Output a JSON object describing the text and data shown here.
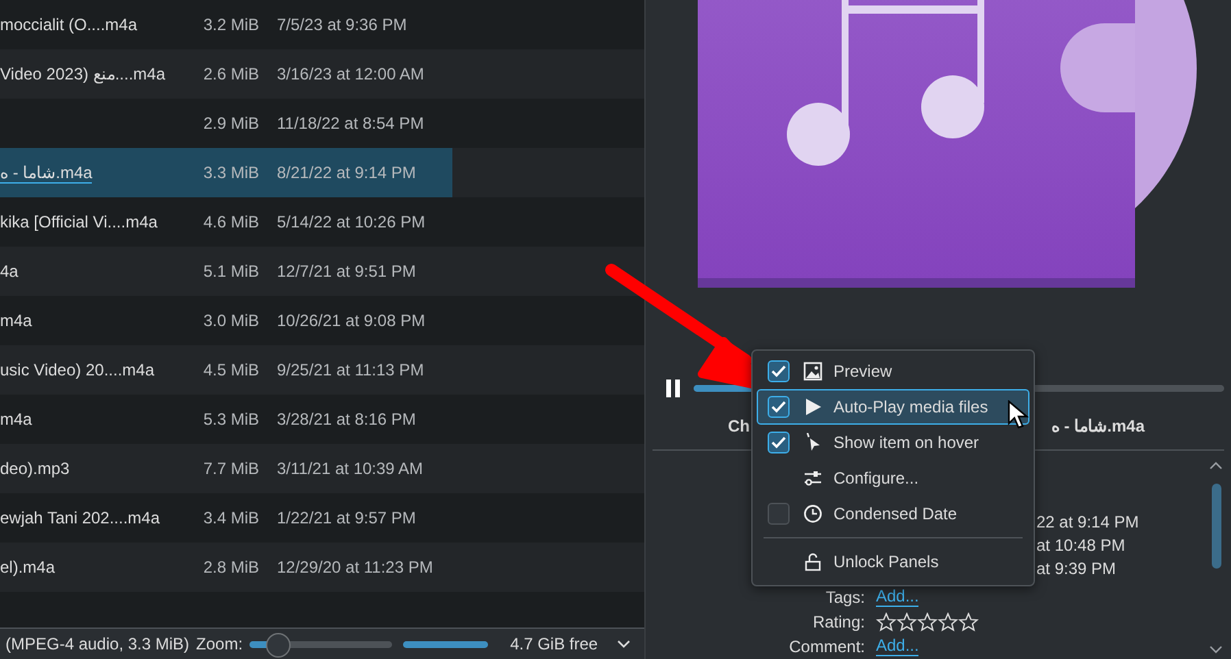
{
  "file_list": {
    "rows": [
      {
        "name": "moccialit  (O....m4a",
        "size": "3.2 MiB",
        "modified": "7/5/23 at 9:36 PM",
        "selected": false
      },
      {
        "name": "Video 2023)  منع....m4a",
        "size": "2.6 MiB",
        "modified": "3/16/23 at 12:00 AM",
        "selected": false
      },
      {
        "size": "2.9 MiB",
        "modified": "11/18/22 at 8:54 PM",
        "selected": false
      },
      {
        "name": "شاما - ه.m4a",
        "size": "3.3 MiB",
        "modified": "8/21/22 at 9:14 PM",
        "selected": true
      },
      {
        "name": "kika [Official Vi....m4a",
        "size": "4.6 MiB",
        "modified": "5/14/22 at 10:26 PM",
        "selected": false
      },
      {
        "name": "4a",
        "size": "5.1 MiB",
        "modified": "12/7/21 at 9:51 PM",
        "selected": false
      },
      {
        "name": "m4a",
        "size": "3.0 MiB",
        "modified": "10/26/21 at 9:08 PM",
        "selected": false
      },
      {
        "name": "usic Video)  20....m4a",
        "size": "4.5 MiB",
        "modified": "9/25/21 at 11:13 PM",
        "selected": false
      },
      {
        "name": "m4a",
        "size": "5.3 MiB",
        "modified": "3/28/21 at 8:16 PM",
        "selected": false
      },
      {
        "name": "deo).mp3",
        "size": "7.7 MiB",
        "modified": "3/11/21 at 10:39 AM",
        "selected": false
      },
      {
        "name": "ewjah Tani  202....m4a",
        "size": "3.4 MiB",
        "modified": "1/22/21 at 9:57 PM",
        "selected": false
      },
      {
        "name": "el).m4a",
        "size": "2.8 MiB",
        "modified": "12/29/20 at 11:23 PM",
        "selected": false
      }
    ]
  },
  "status_bar": {
    "info": "(MPEG-4 audio, 3.3 MiB)",
    "zoom_label": "Zoom:",
    "zoom": {
      "level": 0.2
    },
    "space": {
      "level": 1,
      "free": "4.7 GiB free"
    }
  },
  "information_panel": {
    "player": {
      "playing": true,
      "level": 0.12
    },
    "title_start": "Ch",
    "title_end": "شاما - ه.m4a",
    "details": [
      {
        "value": "22 at 9:14 PM"
      },
      {
        "value": "at 10:48 PM"
      },
      {
        "value": "at 9:39 PM"
      }
    ],
    "tags": {
      "label": "Tags:",
      "link": "Add..."
    },
    "rating": {
      "label": "Rating:",
      "stars": 0
    },
    "comment": {
      "label": "Comment:",
      "link": "Add..."
    }
  },
  "context_menu": {
    "items": [
      {
        "kind": "check",
        "label": "Preview",
        "checked": true,
        "selected": false
      },
      {
        "kind": "check",
        "label": "Auto-Play media files",
        "checked": true,
        "selected": true
      },
      {
        "kind": "check",
        "label": "Show item on hover",
        "checked": true,
        "selected": false
      },
      {
        "kind": "action",
        "label": "Configure...",
        "selected": false
      },
      {
        "kind": "check",
        "label": "Condensed Date",
        "checked": false,
        "selected": false
      },
      {
        "kind": "separator"
      },
      {
        "kind": "action",
        "label": "Unlock Panels",
        "selected": false
      }
    ]
  }
}
